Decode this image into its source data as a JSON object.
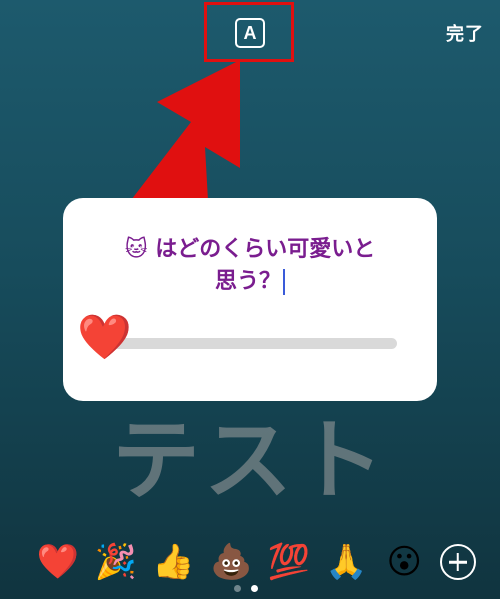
{
  "toolbar": {
    "font_button_label": "A",
    "done_label": "完了"
  },
  "background_text": "テスト",
  "poll_sticker": {
    "question_emoji": "🐱",
    "question_line1": "はどのくらい可愛いと",
    "question_line2": "思う？",
    "slider_emoji": "❤️",
    "slider_value": 0
  },
  "emoji_tray": {
    "items": [
      "❤️",
      "🎉",
      "👍",
      "💩",
      "💯",
      "🙏",
      "😮"
    ],
    "add_icon": "plus-circle-icon"
  },
  "page_indicator": {
    "count": 2,
    "active_index": 1
  },
  "colors": {
    "annotation_red": "#e01010",
    "question_text": "#7a1d8f",
    "caret": "#3a5bd9"
  }
}
